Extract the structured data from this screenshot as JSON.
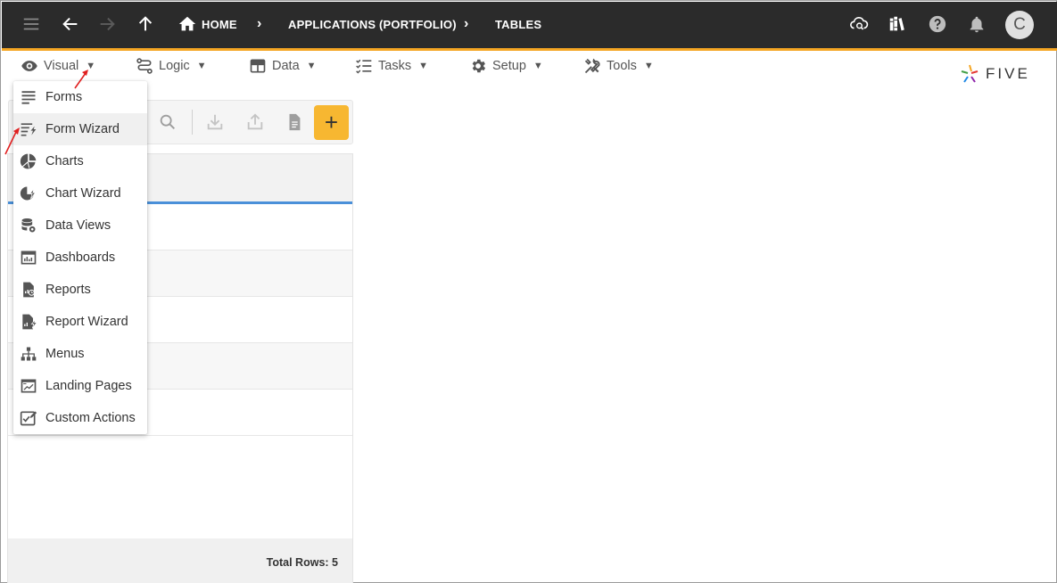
{
  "topbar": {
    "breadcrumbs": [
      {
        "label": "HOME"
      },
      {
        "label": "APPLICATIONS (PORTFOLIO)"
      },
      {
        "label": "TABLES"
      }
    ],
    "avatar_letter": "C"
  },
  "menubar": {
    "items": [
      {
        "label": "Visual"
      },
      {
        "label": "Logic"
      },
      {
        "label": "Data"
      },
      {
        "label": "Tasks"
      },
      {
        "label": "Setup"
      },
      {
        "label": "Tools"
      }
    ]
  },
  "logo": {
    "text": "FIVE"
  },
  "dropdown": {
    "items": [
      {
        "label": "Forms",
        "icon": "forms-icon"
      },
      {
        "label": "Form Wizard",
        "icon": "form-wizard-icon"
      },
      {
        "label": "Charts",
        "icon": "charts-icon"
      },
      {
        "label": "Chart Wizard",
        "icon": "chart-wizard-icon"
      },
      {
        "label": "Data Views",
        "icon": "data-views-icon"
      },
      {
        "label": "Dashboards",
        "icon": "dashboards-icon"
      },
      {
        "label": "Reports",
        "icon": "reports-icon"
      },
      {
        "label": "Report Wizard",
        "icon": "report-wizard-icon"
      },
      {
        "label": "Menus",
        "icon": "menus-icon"
      },
      {
        "label": "Landing Pages",
        "icon": "landing-pages-icon"
      },
      {
        "label": "Custom Actions",
        "icon": "custom-actions-icon"
      }
    ]
  },
  "panel": {
    "add_label": "+",
    "total_rows": "Total Rows: 5"
  },
  "colors": {
    "topbar": "#2b2b2b",
    "accent": "#f5a623",
    "add_button": "#f7b731",
    "list_header_underline": "#4a90d9",
    "annotation_arrow": "#e02020"
  }
}
